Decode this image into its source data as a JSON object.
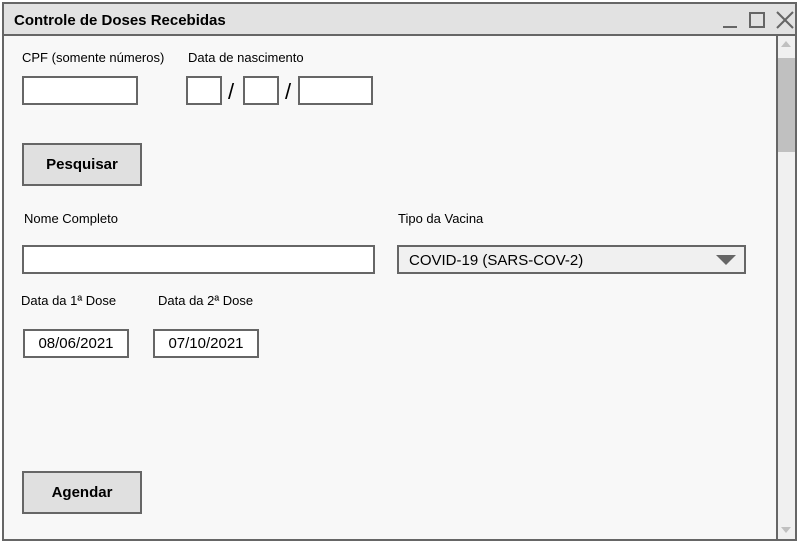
{
  "window": {
    "title": "Controle de Doses Recebidas",
    "controls": [
      "minimize-icon",
      "maximize-icon",
      "close-icon"
    ]
  },
  "search": {
    "cpf_label": "CPF (somente números)",
    "cpf_value": "",
    "birth_label": "Data de nascimento",
    "birth_day": "",
    "birth_month": "",
    "birth_year": "",
    "separator": "/",
    "button_label": "Pesquisar"
  },
  "form": {
    "name_label": "Nome Completo",
    "name_value": "",
    "vaccine_label": "Tipo da Vacina",
    "vaccine_value": "COVID-19 (SARS-COV-2)",
    "dose1_label": "Data da 1ª Dose",
    "dose1_value": "08/06/2021",
    "dose2_label": "Data da 2ª Dose",
    "dose2_value": "07/10/2021",
    "schedule_label": "Agendar"
  },
  "colors": {
    "border": "#666666",
    "titlebar": "#e2e2e2",
    "button": "#e0e0e0",
    "background": "#f8f8f8"
  }
}
